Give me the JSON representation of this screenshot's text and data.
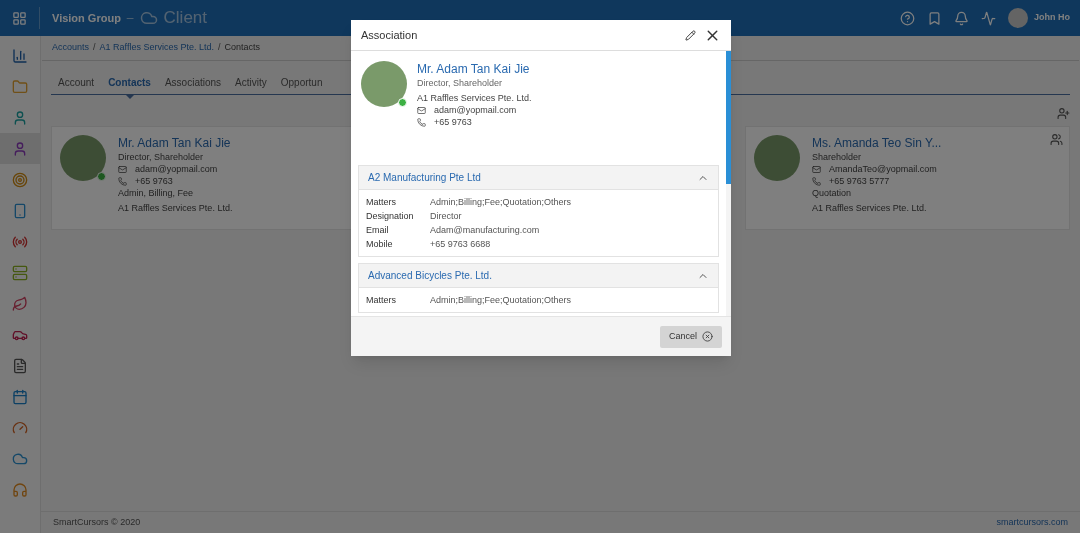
{
  "header": {
    "app_group": "Vision Group",
    "separator": "–",
    "module": "Client",
    "user": "John Ho"
  },
  "sidebar": {
    "items": [
      {
        "selected": false
      },
      {
        "selected": false
      },
      {
        "selected": false
      },
      {
        "selected": true
      },
      {
        "selected": false
      },
      {
        "selected": false
      },
      {
        "selected": false
      },
      {
        "selected": false
      },
      {
        "selected": false
      },
      {
        "selected": false
      },
      {
        "selected": false
      },
      {
        "selected": false
      },
      {
        "selected": false
      },
      {
        "selected": false
      },
      {
        "selected": false
      }
    ]
  },
  "breadcrumb": [
    {
      "label": "Accounts",
      "separator": "/"
    },
    {
      "label": "A1 Raffles Services Pte. Ltd.",
      "separator": "/"
    },
    {
      "label": "Contacts"
    }
  ],
  "tabs": [
    {
      "label": "Account",
      "selected": false
    },
    {
      "label": "Contacts",
      "selected": true
    },
    {
      "label": "Associations",
      "selected": false
    },
    {
      "label": "Activity",
      "selected": false
    },
    {
      "label": "Opportun",
      "selected": false
    }
  ],
  "contacts": [
    {
      "name": "Mr. Adam Tan Kai Jie",
      "roles": "Director, Shareholder",
      "email": "adam@yopmail.com",
      "phone": "+65 9763",
      "matters": "Admin, Billing, Fee",
      "company": "A1 Raffles Services Pte. Ltd.",
      "online": true
    },
    {
      "name": "Ms. Amanda Teo Sin Y...",
      "roles": "Shareholder",
      "email": "AmandaTeo@yopmail.com",
      "phone": "+65 9763 5777",
      "matters": "Quotation",
      "company": "A1 Raffles Services Pte. Ltd.",
      "online": false
    }
  ],
  "footer": {
    "copyright": "SmartCursors © 2020",
    "link": "smartcursors.com"
  },
  "dialog": {
    "title": "Association",
    "contact": {
      "name": "Mr. Adam Tan Kai Jie",
      "roles": "Director, Shareholder",
      "company": "A1 Raffles Services Pte. Ltd.",
      "email": "adam@yopmail.com",
      "phone": "+65 9763",
      "online": true
    },
    "sections": [
      {
        "title": "A2 Manufacturing Pte Ltd",
        "expanded": true,
        "fields": [
          {
            "label": "Matters",
            "value": "Admin;Billing;Fee;Quotation;Others"
          },
          {
            "label": "Designation",
            "value": "Director"
          },
          {
            "label": "Email",
            "value": "Adam@manufacturing.com"
          },
          {
            "label": "Mobile",
            "value": "+65 9763 6688"
          }
        ]
      },
      {
        "title": "Advanced Bicycles Pte. Ltd.",
        "expanded": true,
        "fields": [
          {
            "label": "Matters",
            "value": "Admin;Billing;Fee;Quotation;Others"
          }
        ]
      }
    ],
    "cancel": "Cancel"
  }
}
